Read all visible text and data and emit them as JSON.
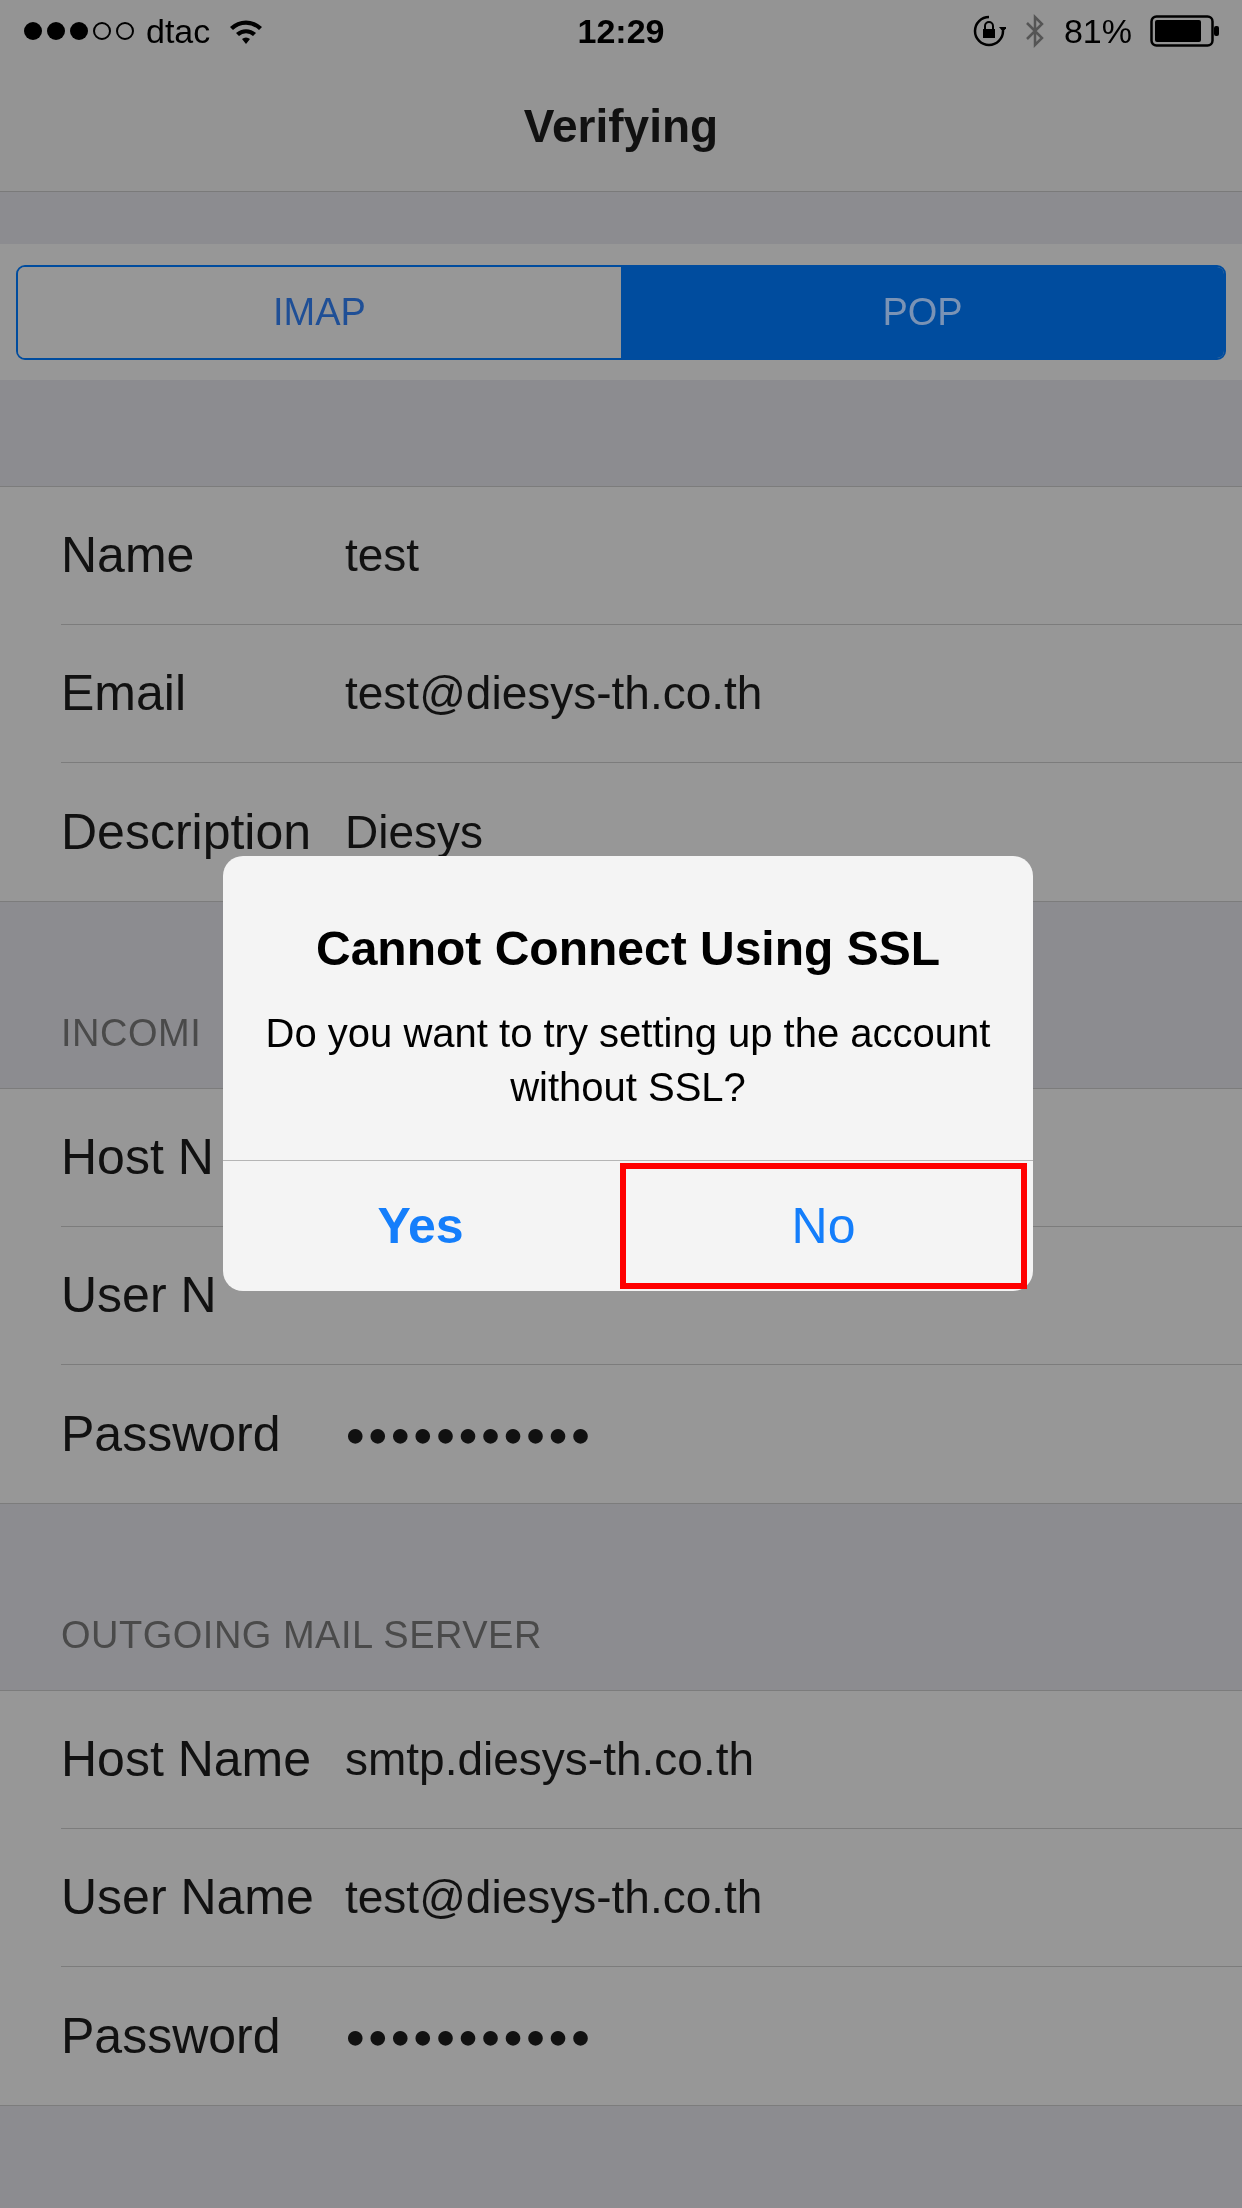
{
  "status_bar": {
    "carrier": "dtac",
    "time": "12:29",
    "battery": "81%"
  },
  "nav_bar": {
    "title": "Verifying"
  },
  "segments": [
    {
      "label": "IMAP",
      "selected": false
    },
    {
      "label": "POP",
      "selected": true
    }
  ],
  "sections": [
    {
      "rows": [
        {
          "label": "Name",
          "value": "test",
          "kind": "text"
        },
        {
          "label": "Email",
          "value": "test@diesys-th.co.th",
          "kind": "text"
        },
        {
          "label": "Description",
          "value": "Diesys",
          "kind": "text"
        }
      ]
    },
    {
      "header": "INCOMI",
      "rows": [
        {
          "label": "Host N",
          "kind": "covered"
        },
        {
          "label": "User N",
          "kind": "covered"
        },
        {
          "label": "Password",
          "value": "●●●●●●●●●●●",
          "kind": "password"
        }
      ]
    },
    {
      "header": "OUTGOING MAIL SERVER",
      "rows": [
        {
          "label": "Host Name",
          "value": "smtp.diesys-th.co.th",
          "kind": "text"
        },
        {
          "label": "User Name",
          "value": "test@diesys-th.co.th",
          "kind": "text"
        },
        {
          "label": "Password",
          "value": "●●●●●●●●●●●",
          "kind": "password"
        }
      ]
    }
  ],
  "alert": {
    "title": "Cannot Connect Using SSL",
    "message": "Do you want to try setting up the account without SSL?",
    "buttons": [
      {
        "label": "Yes",
        "preferred": true,
        "highlighted": false
      },
      {
        "label": "No",
        "preferred": false,
        "highlighted": true
      }
    ]
  }
}
